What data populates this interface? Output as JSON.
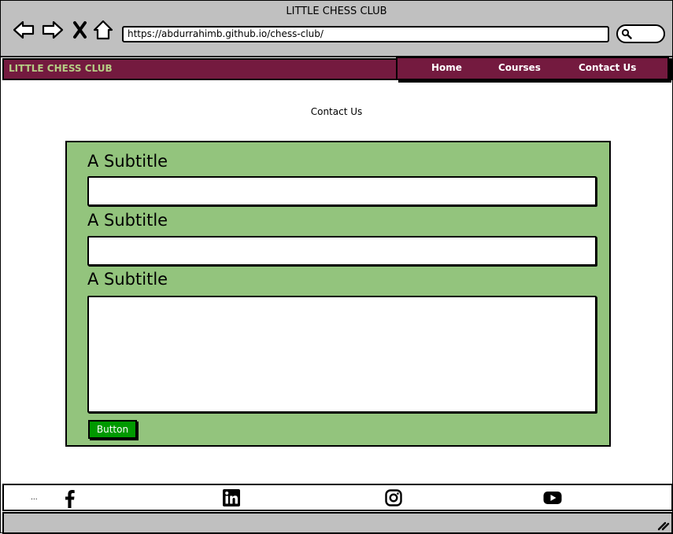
{
  "window": {
    "title": "LITTLE CHESS CLUB"
  },
  "browser": {
    "url": "https://abdurrahimb.github.io/chess-club/"
  },
  "nav": {
    "brand": "LITTLE CHESS CLUB",
    "items": [
      {
        "label": "Home"
      },
      {
        "label": "Courses"
      },
      {
        "label": "Contact Us"
      }
    ]
  },
  "page": {
    "title": "Contact Us"
  },
  "form": {
    "fields": [
      {
        "label": "A Subtitle",
        "value": ""
      },
      {
        "label": "A Subtitle",
        "value": ""
      },
      {
        "label": "A Subtitle",
        "value": ""
      }
    ],
    "button_label": "Button"
  },
  "footer": {
    "ellipsis": "...",
    "icons": [
      "facebook-icon",
      "linkedin-icon",
      "instagram-icon",
      "youtube-icon"
    ]
  },
  "colors": {
    "nav_bg": "#741a3f",
    "brand_text": "#b5cd84",
    "form_bg": "#93c47d",
    "button_bg": "#009900",
    "chrome_bg": "#c0c0c0"
  }
}
